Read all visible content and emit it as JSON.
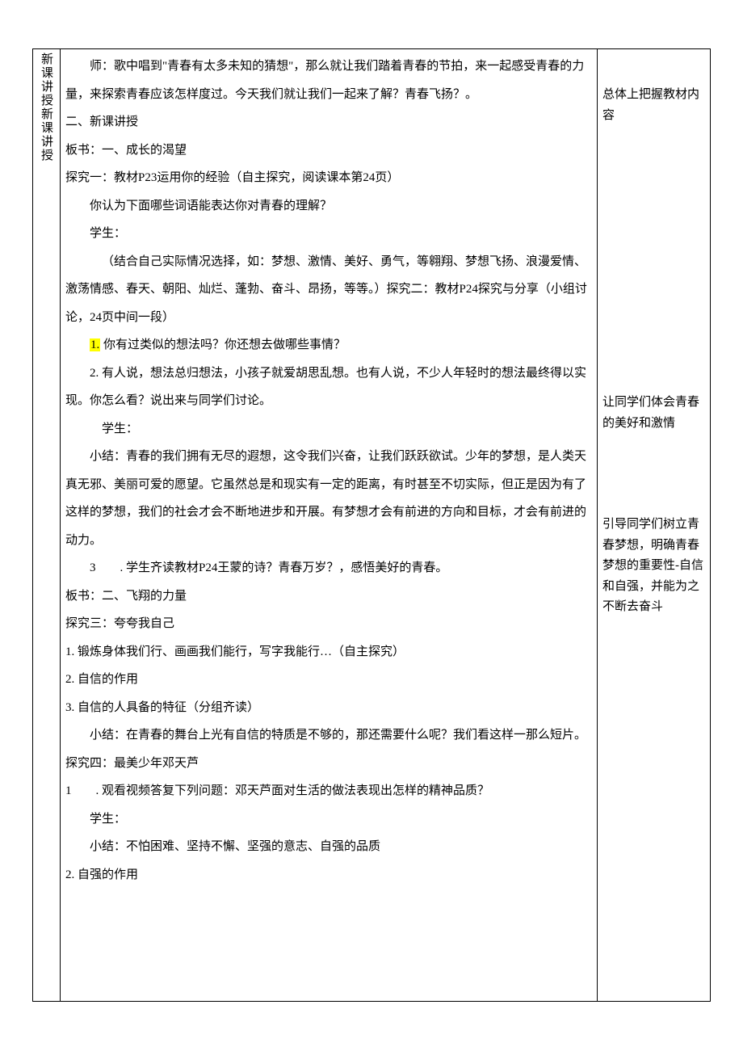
{
  "label_col": "新课讲授新课讲授",
  "main": {
    "p01": "师：歌中唱到\"青春有太多未知的猜想\"，那么就让我们踏着青春的节拍，来一起感受青春的力量，来探索青春应该怎样度过。今天我们就让我们一起来了解？青春飞扬？。",
    "p02": "二、新课讲授",
    "p03": "板书：一、成长的渴望",
    "p04": "探究一：教材P23运用你的经验（自主探究，阅读课本第24页）",
    "p05": "你认为下面哪些词语能表达你对青春的理解？",
    "p06": "学生：",
    "p07": "（结合自己实际情况选择，如：梦想、激情、美好、勇气，等翱翔、梦想飞扬、浪漫爱情、激荡情感、春天、朝阳、灿烂、蓬勃、奋斗、昂扬，等等。）探究二：教材P24探究与分享（小组讨论，24页中间一段）",
    "p08_hl": "1.",
    "p08_rest": " 你有过类似的想法吗？你还想去做哪些事情？",
    "p09": "2. 有人说，想法总归想法，小孩子就爱胡思乱想。也有人说，不少人年轻时的想法最终得以实现。你怎么看？说出来与同学们讨论。",
    "p10": "学生：",
    "p11": "小结：青春的我们拥有无尽的遐想，这令我们兴奋，让我们跃跃欲试。少年的梦想，是人类天真无邪、美丽可爱的愿望。它虽然总是和现实有一定的距离，有时甚至不切实际，但正是因为有了这样的梦想，我们的社会才会不断地进步和开展。有梦想才会有前进的方向和目标，才会有前进的动力。",
    "p12": "3  . 学生齐读教材P24王蒙的诗？青春万岁？，感悟美好的青春。",
    "p13": "板书：二、飞翔的力量",
    "p14": "探究三：夸夸我自己",
    "p15": "1. 锻炼身体我们行、画画我们能行，写字我能行…（自主探究）",
    "p16": "2. 自信的作用",
    "p17": "3. 自信的人具备的特征（分组齐读）",
    "p18": "小结：在青春的舞台上光有自信的特质是不够的，那还需要什么呢？我们看这样一那么短片。",
    "p19": "探究四：最美少年邓天芦",
    "p20": "1  . 观看视频答复下列问题：邓天芦面对生活的做法表现出怎样的精神品质？",
    "p21": "学生：",
    "p22": "小结：不怕困难、坚持不懈、坚强的意志、自强的品质",
    "p23": "2. 自强的作用"
  },
  "side": {
    "s1": "总体上把握教材内容",
    "s2": "让同学们体会青春的美好和激情",
    "s3": "引导同学们树立青春梦想，明确青春梦想的重要性-自信和自强，并能为之不断去奋斗"
  }
}
